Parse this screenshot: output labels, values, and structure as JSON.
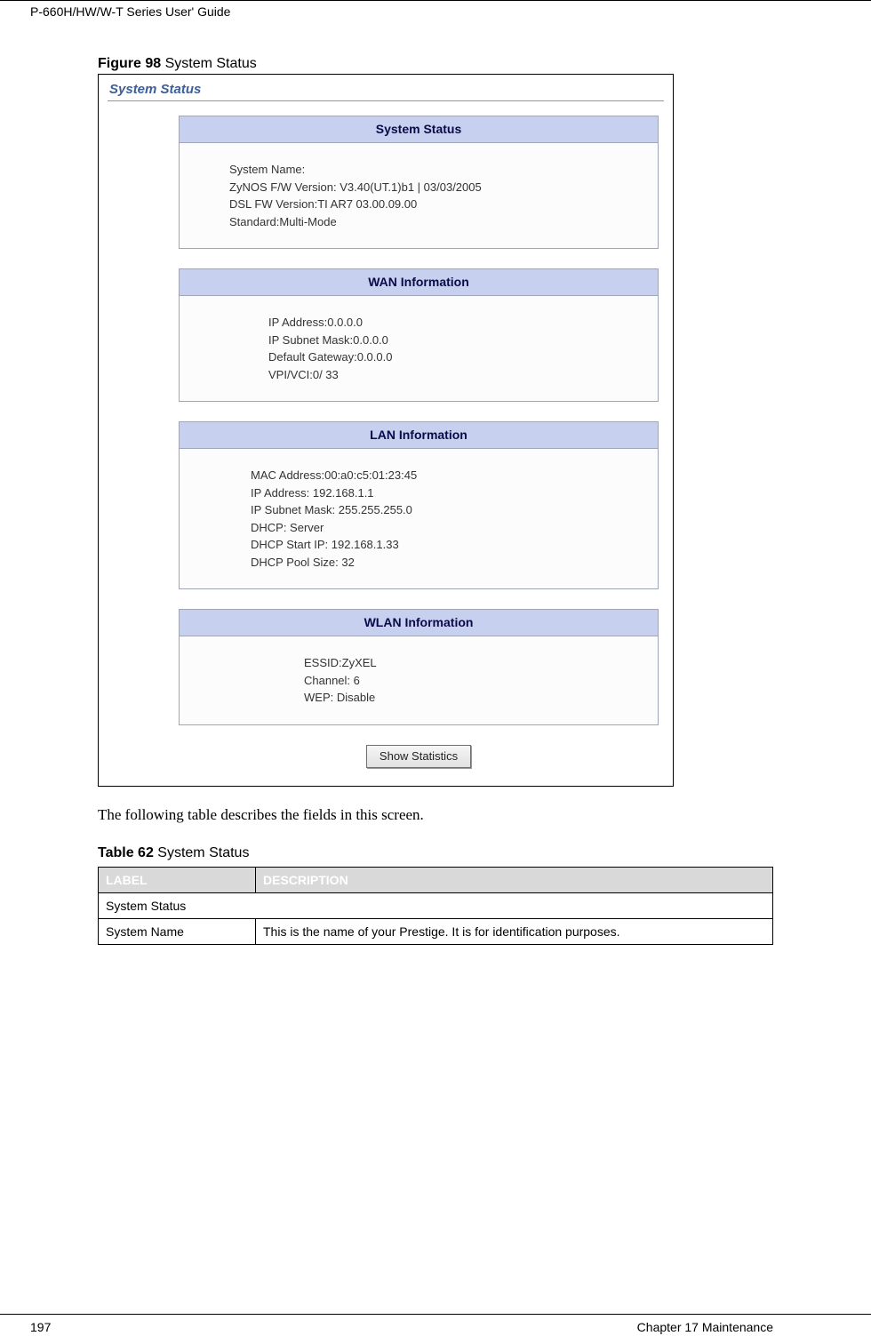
{
  "header": {
    "running": "P-660H/HW/W-T Series User' Guide"
  },
  "figure": {
    "caption_bold": "Figure 98",
    "caption_rest": "   System Status"
  },
  "screenshot": {
    "title": "System Status",
    "panels": {
      "system": {
        "header": "System Status",
        "lines": {
          "l1": "System Name:",
          "l2": "ZyNOS F/W Version: V3.40(UT.1)b1 | 03/03/2005",
          "l3": "DSL FW Version:TI AR7 03.00.09.00",
          "l4": "Standard:Multi-Mode"
        }
      },
      "wan": {
        "header": "WAN Information",
        "lines": {
          "l1": "IP Address:0.0.0.0",
          "l2": "IP Subnet Mask:0.0.0.0",
          "l3": "Default Gateway:0.0.0.0",
          "l4": "VPI/VCI:0/ 33"
        }
      },
      "lan": {
        "header": "LAN Information",
        "lines": {
          "l1": "MAC Address:00:a0:c5:01:23:45",
          "l2": "IP Address: 192.168.1.1",
          "l3": "IP Subnet Mask: 255.255.255.0",
          "l4": "DHCP: Server",
          "l5": "DHCP Start IP: 192.168.1.33",
          "l6": "DHCP Pool Size: 32"
        }
      },
      "wlan": {
        "header": "WLAN Information",
        "lines": {
          "l1": "ESSID:ZyXEL",
          "l2": "Channel: 6",
          "l3": "WEP: Disable"
        }
      }
    },
    "button": "Show Statistics"
  },
  "body_text": "The following table describes the fields in this screen.",
  "table": {
    "caption_bold": "Table 62",
    "caption_rest": "   System Status",
    "head": {
      "label": "LABEL",
      "desc": "DESCRIPTION"
    },
    "rows": {
      "r1": {
        "label": "System Status",
        "desc": ""
      },
      "r2": {
        "label": "System Name",
        "desc": "This is the name of your Prestige. It is for identification purposes."
      }
    }
  },
  "footer": {
    "page": "197",
    "chapter": "Chapter 17 Maintenance"
  }
}
